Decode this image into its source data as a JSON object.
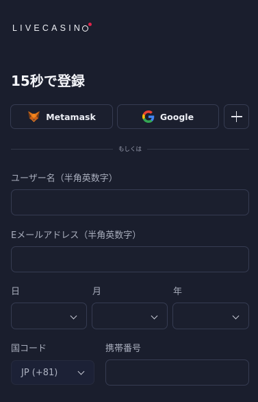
{
  "logo": {
    "text": "LIVECASIN"
  },
  "page": {
    "title": "15秒で登録"
  },
  "social": {
    "metamask_label": "Metamask",
    "google_label": "Google"
  },
  "divider": {
    "text": "もしくは"
  },
  "form": {
    "username_label": "ユーザー名（半角英数字）",
    "email_label": "Eメールアドレス（半角英数字）",
    "day_label": "日",
    "month_label": "月",
    "year_label": "年",
    "country_code_label": "国コード",
    "phone_label": "携帯番号",
    "country_code_value": "JP (+81)"
  },
  "colors": {
    "background": "#1a1e2d",
    "border": "#363c52",
    "logo_dot": "#e0244a"
  }
}
